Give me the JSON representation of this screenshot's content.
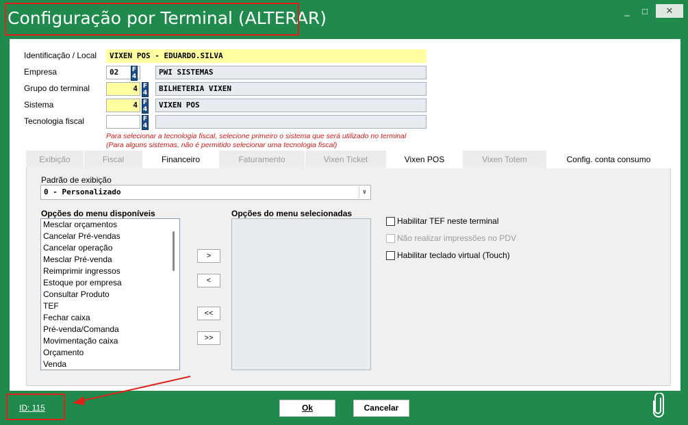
{
  "window": {
    "title": "Configuração por Terminal (ALTERAR)",
    "minimize_glyph": "_",
    "maximize_glyph": "□",
    "close_glyph": "✕"
  },
  "form": {
    "identificacao_label": "Identificação / Local",
    "identificacao_value": "VIXEN POS - EDUARDO.SILVA",
    "empresa_label": "Empresa",
    "empresa_code": "02",
    "empresa_name": "PWI SISTEMAS",
    "grupo_label": "Grupo do terminal",
    "grupo_code": "4",
    "grupo_name": "BILHETERIA VIXEN",
    "sistema_label": "Sistema",
    "sistema_code": "4",
    "sistema_name": "VIXEN POS",
    "tecnologia_label": "Tecnologia fiscal",
    "tecnologia_code": "",
    "tecnologia_name": "",
    "lookup_key": "F4",
    "warning_line1": "Para selecionar a tecnologia fiscal, selecione primeiro o sistema que será utilizado no terminal",
    "warning_line2": "(Para alguns sistemas, não é permitido selecionar uma tecnologia fiscal)"
  },
  "tabs": [
    {
      "label": "Exibição",
      "active": false
    },
    {
      "label": "Fiscal",
      "active": false
    },
    {
      "label": "Financeiro",
      "active": true
    },
    {
      "label": "Faturamento",
      "active": false
    },
    {
      "label": "Vixen Ticket",
      "active": false
    },
    {
      "label": "Vixen POS",
      "active": true
    },
    {
      "label": "Vixen Totem",
      "active": false
    },
    {
      "label": "Config. conta consumo",
      "active": true
    }
  ],
  "display": {
    "padrao_label": "Padrão de exibição",
    "padrao_value": "0 - Personalizado",
    "available_title": "Opções do menu disponíveis",
    "selected_title": "Opções do menu selecionadas",
    "available_items": [
      "Mesclar orçamentos",
      "Cancelar Pré-vendas",
      "Cancelar operação",
      "Mesclar Pré-venda",
      "Reimprimir ingressos",
      "Estoque por empresa",
      "Consultar Produto",
      "TEF",
      "Fechar caixa",
      "Pré-venda/Comanda",
      "Movimentação caixa",
      "Orçamento",
      "Venda"
    ],
    "move_right": ">",
    "move_left": "<",
    "move_all_left": "<<",
    "move_all_right": ">>"
  },
  "options": {
    "tef_label": "Habilitar TEF neste terminal",
    "no_print_label": "Não realizar impressões no PDV",
    "touch_label": "Habilitar teclado virtual (Touch)"
  },
  "footer": {
    "id_text": "ID: 115",
    "ok_label": "Ok",
    "cancel_label": "Cancelar"
  },
  "colors": {
    "window_green": "#1f8a4c",
    "highlight_red": "#e0201a",
    "required_yellow": "#ffffa0",
    "warning_red": "#d11a1a",
    "f4_blue": "#1c4e8a"
  }
}
